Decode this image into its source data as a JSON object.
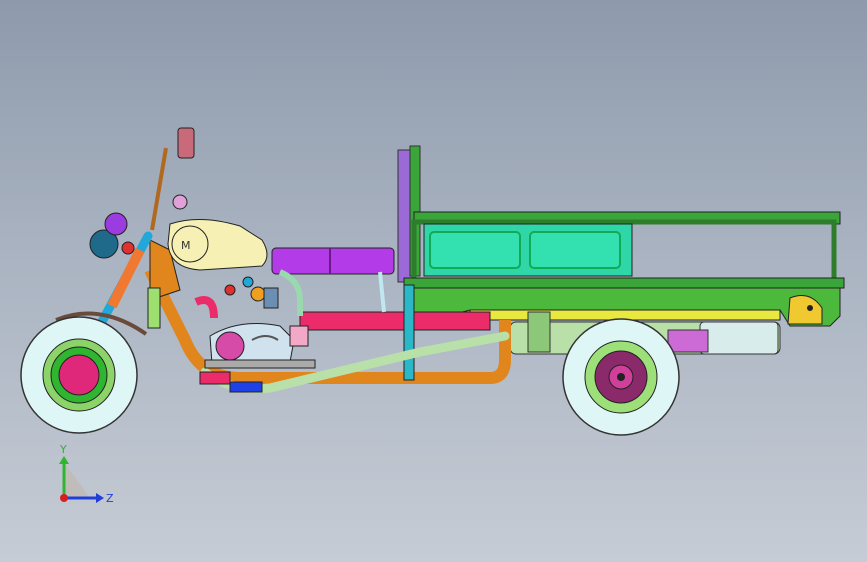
{
  "viewport": {
    "background_top": "#8e9aac",
    "background_bottom": "#c6ccd5"
  },
  "triad": {
    "y_label": "Y",
    "z_label": "Z",
    "y_color": "#2fb52f",
    "z_color": "#1f3fd8",
    "x_color": "#d81f1f"
  },
  "model": {
    "name": "tricycle-assembly",
    "colors": {
      "tire": "#dff6f6",
      "frame_orange": "#e0861c",
      "cargo_bed": "#3aa63a",
      "bed_panel": "#2fd6a8",
      "seat": "#b43ce8",
      "fuel_tank": "#f6f0b4",
      "engine_pink": "#ec2c6a",
      "fork_orange": "#f07830",
      "fork_blue": "#22a8d8"
    }
  }
}
